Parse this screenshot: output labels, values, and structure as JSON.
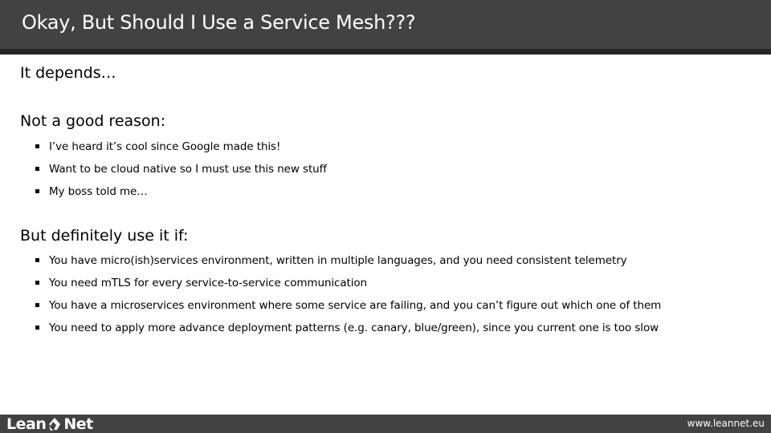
{
  "header": {
    "title": "Okay, But Should I Use a Service Mesh???"
  },
  "content": {
    "lead": "It depends…",
    "sections": [
      {
        "heading": "Not a good reason:",
        "bullets": [
          "I’ve heard it’s cool since Google made this!",
          "Want to be cloud native so I must use this new stuff",
          "My boss told me…"
        ]
      },
      {
        "heading": "But definitely use it if:",
        "bullets": [
          "You have micro(ish)services environment,  written in multiple languages, and you need consistent telemetry",
          "You need mTLS for every service-to-service communication",
          "You have a microservices environment where some service are failing, and you can’t figure out which one of them",
          "You need to apply more advance deployment patterns (e.g. canary, blue/green), since you current one is too slow"
        ]
      }
    ]
  },
  "footer": {
    "logo_left": "Lean",
    "logo_icon": "leannet-logo-icon",
    "logo_right": "Net",
    "website": "www.leannet.eu"
  },
  "colors": {
    "header_bg": "#424242",
    "header_strip": "#262626",
    "footer_bg": "#424242",
    "text": "#000000",
    "header_text": "#ffffff"
  }
}
